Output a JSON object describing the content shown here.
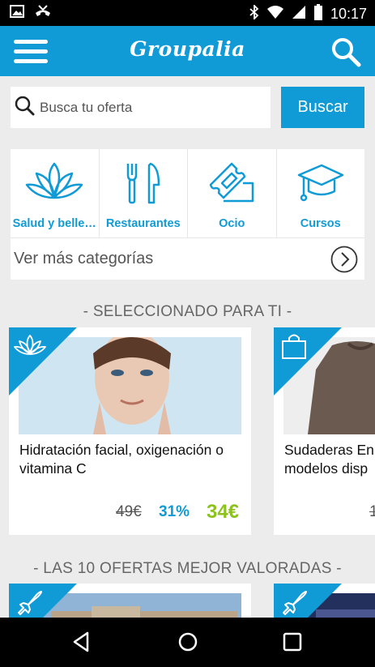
{
  "status_bar": {
    "time": "10:17"
  },
  "app_bar": {
    "logo": "Groupalia"
  },
  "search": {
    "placeholder": "Busca tu oferta",
    "button_label": "Buscar"
  },
  "categories": {
    "items": [
      {
        "label": "Salud y belle…",
        "icon": "lotus-icon"
      },
      {
        "label": "Restaurantes",
        "icon": "fork-knife-icon"
      },
      {
        "label": "Ocio",
        "icon": "ticket-icon"
      },
      {
        "label": "Cursos",
        "icon": "graduation-cap-icon"
      }
    ],
    "more_label": "Ver más categorías"
  },
  "section_selected": {
    "title": "- SELECCIONADO PARA TI -"
  },
  "deals": [
    {
      "title": "Hidratación facial, oxigenación o vitamina C",
      "old_price": "49€",
      "discount": "31%",
      "price": "34€",
      "icon": "lotus-icon"
    },
    {
      "title": "Sudaderas En modelos disp",
      "old_price": "1",
      "icon": "shopping-bag-icon"
    }
  ],
  "section_top": {
    "title": "- LAS 10 OFERTAS MEJOR VALORADAS -"
  },
  "top_deals": [
    {
      "icon": "airplane-icon"
    },
    {
      "icon": "airplane-icon"
    }
  ],
  "colors": {
    "accent": "#119bd6",
    "price": "#8cc21c"
  }
}
